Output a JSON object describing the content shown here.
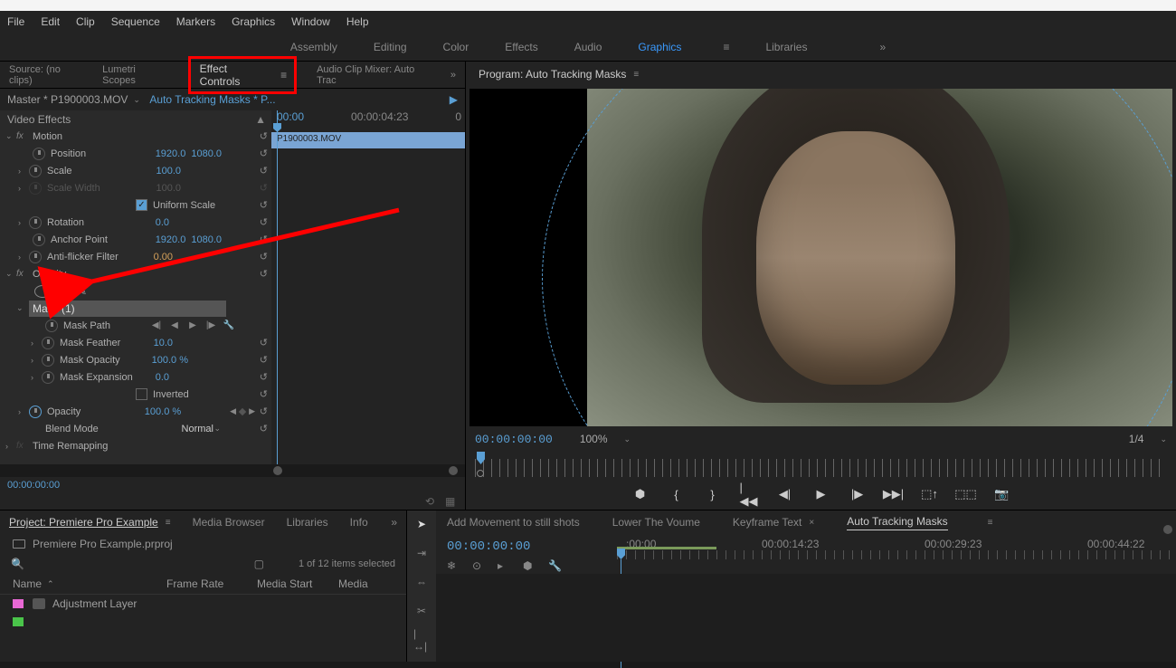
{
  "menubar": {
    "items": [
      "File",
      "Edit",
      "Clip",
      "Sequence",
      "Markers",
      "Graphics",
      "Window",
      "Help"
    ]
  },
  "workspaces": {
    "items": [
      "Assembly",
      "Editing",
      "Color",
      "Effects",
      "Audio",
      "Graphics",
      "Libraries"
    ],
    "active": "Graphics"
  },
  "sourceTabs": {
    "source": "Source: (no clips)",
    "lumetri": "Lumetri Scopes",
    "effectControls": "Effect Controls",
    "audioMixer": "Audio Clip Mixer: Auto Trac"
  },
  "ecHeader": {
    "master": "Master * P1900003.MOV",
    "sequence": "Auto Tracking Masks * P..."
  },
  "ecTimeline": {
    "start": "00:00",
    "end": "00:00:04:23",
    "zero": "0",
    "clip": "P1900003.MOV"
  },
  "videoEffects": {
    "title": "Video Effects",
    "motion": {
      "label": "Motion",
      "position": {
        "label": "Position",
        "x": "1920.0",
        "y": "1080.0"
      },
      "scale": {
        "label": "Scale",
        "val": "100.0"
      },
      "scaleWidth": {
        "label": "Scale Width",
        "val": "100.0"
      },
      "uniform": {
        "label": "Uniform Scale"
      },
      "rotation": {
        "label": "Rotation",
        "val": "0.0"
      },
      "anchor": {
        "label": "Anchor Point",
        "x": "1920.0",
        "y": "1080.0"
      },
      "antiFlicker": {
        "label": "Anti-flicker Filter",
        "val": "0.00"
      }
    },
    "opacity": {
      "label": "Opacity",
      "mask": {
        "label": "Mask (1)"
      },
      "maskPath": {
        "label": "Mask Path"
      },
      "maskFeather": {
        "label": "Mask Feather",
        "val": "10.0"
      },
      "maskOpacity": {
        "label": "Mask Opacity",
        "val": "100.0 %"
      },
      "maskExpansion": {
        "label": "Mask Expansion",
        "val": "0.0"
      },
      "inverted": {
        "label": "Inverted"
      },
      "opacityProp": {
        "label": "Opacity",
        "val": "100.0 %"
      },
      "blendMode": {
        "label": "Blend Mode",
        "val": "Normal"
      }
    },
    "timeRemap": {
      "label": "Time Remapping"
    }
  },
  "ecPlayhead": "00:00:00:00",
  "program": {
    "title": "Program: Auto Tracking Masks",
    "time": "00:00:00:00",
    "zoom": "100%",
    "res": "1/4"
  },
  "projectTabs": {
    "project": "Project: Premiere Pro  Example",
    "mediaBrowser": "Media Browser",
    "libraries": "Libraries",
    "info": "Info"
  },
  "projectName": "Premiere Pro Example.prproj",
  "projectStatus": "1 of 12 items selected",
  "columns": {
    "name": "Name",
    "frameRate": "Frame Rate",
    "mediaStart": "Media Start",
    "mediaEnd": "Media"
  },
  "assets": [
    {
      "name": "Adjustment Layer"
    }
  ],
  "timelineTabs": {
    "t1": "Add Movement to still shots",
    "t2": "Lower The Voume",
    "t3": "Keyframe Text",
    "t4": "Auto Tracking Masks"
  },
  "tlTime": "00:00:00:00",
  "tlRuler": {
    "t0": ":00:00",
    "t1": "00:00:14:23",
    "t2": "00:00:29:23",
    "t3": "00:00:44:22"
  }
}
